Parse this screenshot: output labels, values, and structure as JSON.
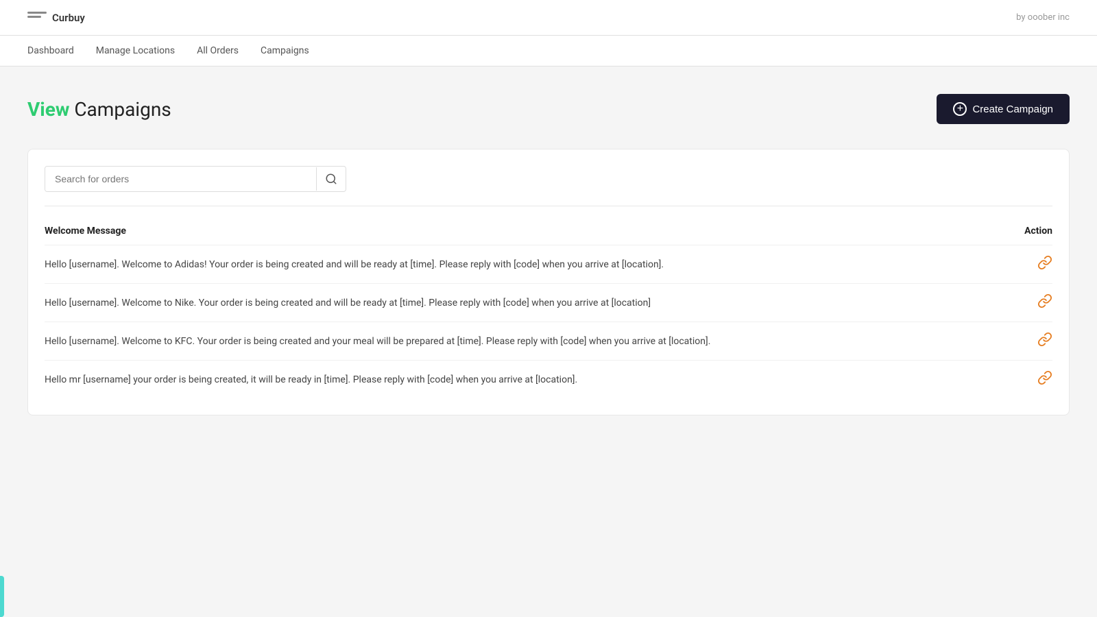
{
  "topbar": {
    "logo_label": "Curbuy",
    "by_label": "by ooober inc"
  },
  "nav": {
    "items": [
      {
        "id": "dashboard",
        "label": "Dashboard"
      },
      {
        "id": "manage-locations",
        "label": "Manage Locations"
      },
      {
        "id": "all-orders",
        "label": "All Orders"
      },
      {
        "id": "campaigns",
        "label": "Campaigns"
      }
    ]
  },
  "page": {
    "title_highlight": "View",
    "title_rest": " Campaigns",
    "create_button_label": "Create Campaign"
  },
  "search": {
    "placeholder": "Search for orders"
  },
  "table": {
    "col_message": "Welcome Message",
    "col_action": "Action",
    "rows": [
      {
        "id": 1,
        "message": "Hello [username]. Welcome to Adidas! Your order is being created and will be ready at [time]. Please reply with [code] when you arrive at [location]."
      },
      {
        "id": 2,
        "message": "Hello [username]. Welcome to Nike. Your order is being created and will be ready at [time]. Please reply with [code] when you arrive at [location]"
      },
      {
        "id": 3,
        "message": "Hello [username]. Welcome to KFC. Your order is being created and your meal will be prepared at [time]. Please reply with [code] when you arrive at [location]."
      },
      {
        "id": 4,
        "message": "Hello mr [username] your order is being created, it will be ready in [time]. Please reply with [code] when you arrive at [location]."
      }
    ]
  }
}
